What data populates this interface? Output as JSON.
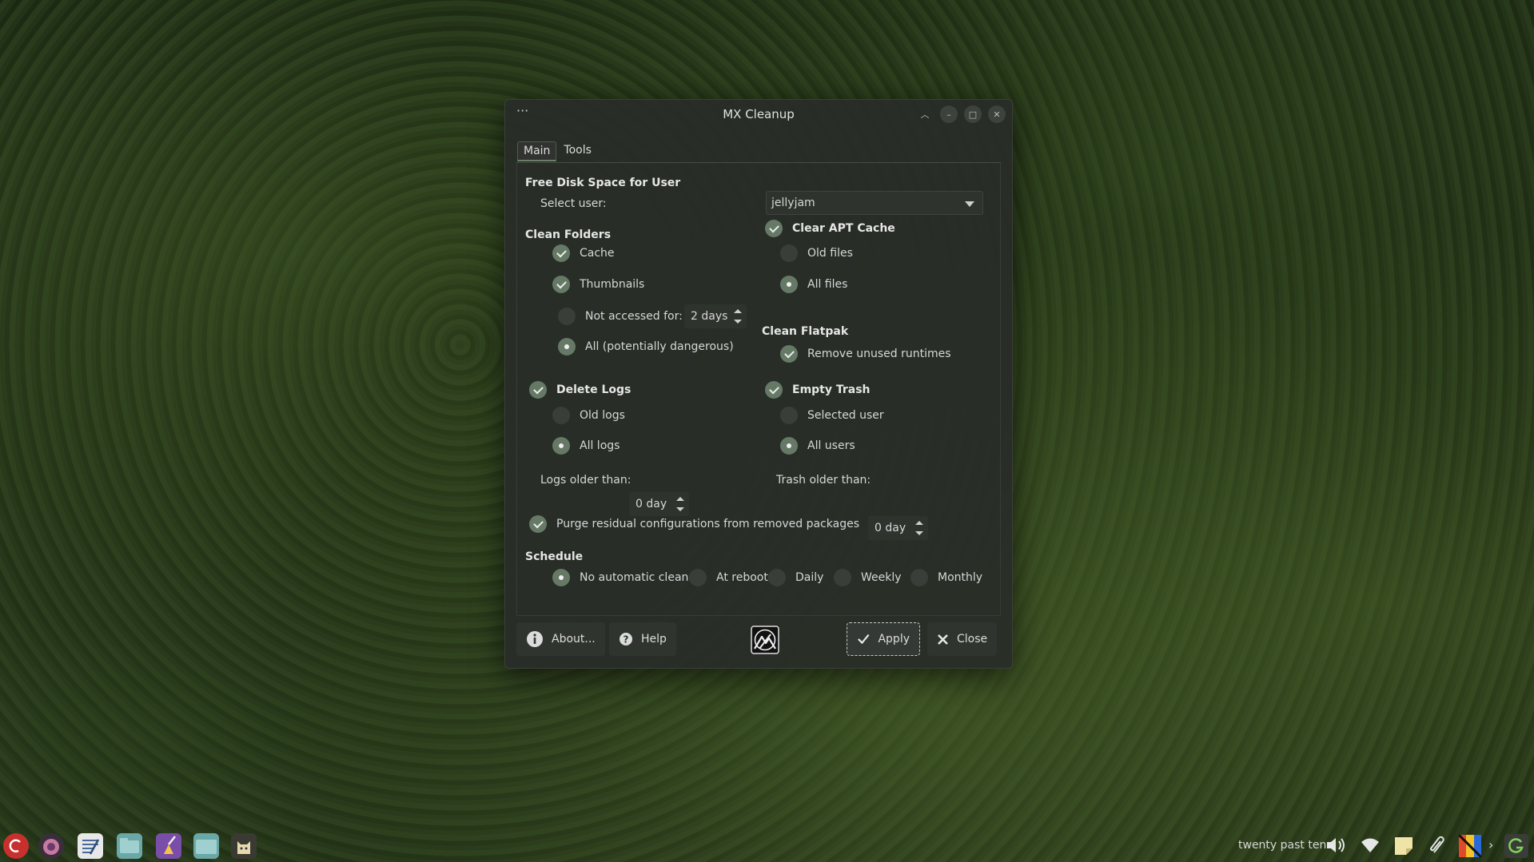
{
  "window": {
    "title": "MX Cleanup",
    "menu_glyph": "···",
    "btn_shade": "︿",
    "btn_min": "–",
    "btn_max": "□",
    "btn_close": "✕"
  },
  "tabs": [
    {
      "label": "Main",
      "active": true
    },
    {
      "label": "Tools",
      "active": false
    }
  ],
  "free_space": {
    "header": "Free Disk Space for User",
    "select_user_label": "Select user:",
    "selected_user": "jellyjam"
  },
  "clean_folders": {
    "header": "Clean Folders",
    "cache": "Cache",
    "thumbnails": "Thumbnails",
    "not_accessed": "Not accessed for:",
    "not_accessed_value": "2 days",
    "all_dangerous": "All (potentially dangerous)"
  },
  "apt_cache": {
    "header": "Clear APT Cache",
    "old_files": "Old files",
    "all_files": "All files"
  },
  "flatpak": {
    "header": "Clean Flatpak",
    "remove_unused": "Remove unused runtimes"
  },
  "delete_logs": {
    "header": "Delete Logs",
    "old_logs": "Old logs",
    "all_logs": "All logs",
    "older_than_label": "Logs older than:",
    "older_than_value": "0 day"
  },
  "empty_trash": {
    "header": "Empty Trash",
    "selected_user": "Selected user",
    "all_users": "All users",
    "older_than_label": "Trash older than:",
    "older_than_value": "0 day"
  },
  "purge": {
    "label": "Purge residual configurations from removed packages"
  },
  "schedule": {
    "header": "Schedule",
    "options": [
      "No automatic clean",
      "At reboot",
      "Daily",
      "Weekly",
      "Monthly"
    ],
    "selected": "No automatic clean"
  },
  "buttons": {
    "about": "About...",
    "help": "Help",
    "apply": "Apply",
    "close": "Close"
  },
  "taskbar": {
    "clock": "twenty past ten",
    "apps": [
      "debian-menu-icon",
      "firefox-icon",
      "text-editor-icon",
      "file-manager-icon",
      "cleanup-icon",
      "folder-icon",
      "cat-app-icon"
    ]
  },
  "colors": {
    "accent": "#667866",
    "window_bg": "#2a2d29",
    "text": "#dcdcdc"
  }
}
